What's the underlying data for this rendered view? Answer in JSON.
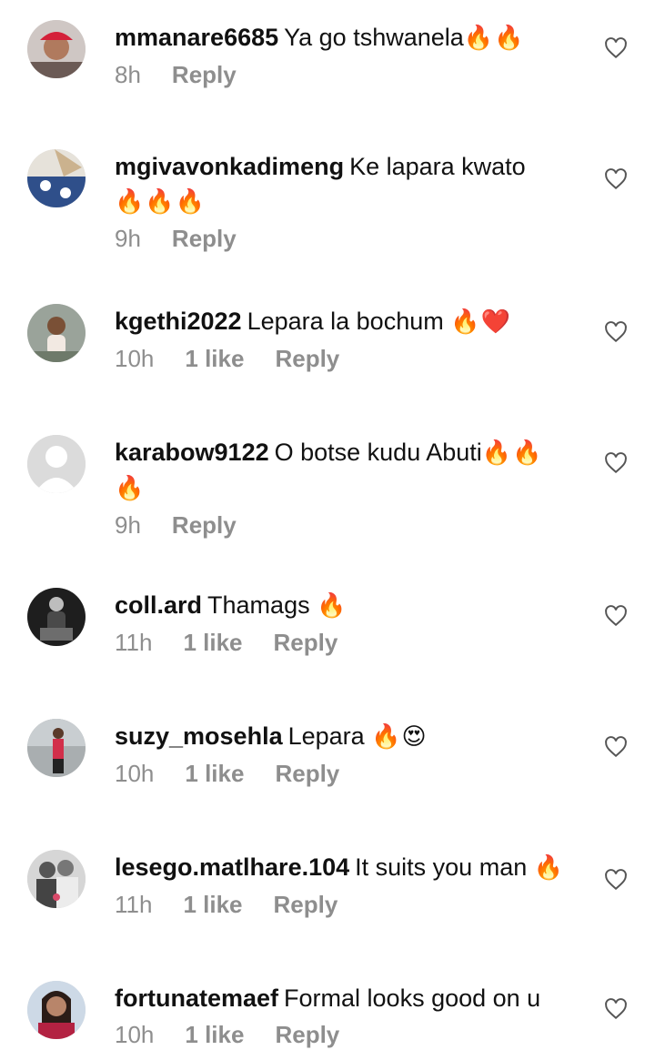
{
  "comments": [
    {
      "username": "mmanare6685",
      "text": "Ya go tshwanela",
      "emoji": "🔥🔥",
      "time": "8h",
      "likes": "",
      "reply": "Reply",
      "avatar": "avatar-woman-red-cap"
    },
    {
      "username": "mgivavonkadimeng",
      "text": "Ke lapara kwato",
      "emoji": "🔥🔥🔥",
      "time": "9h",
      "likes": "",
      "reply": "Reply",
      "avatar": "avatar-blue-pattern"
    },
    {
      "username": "kgethi2022",
      "text": "Lepara la bochum",
      "emoji": "🔥❤️",
      "time": "10h",
      "likes": "1 like",
      "reply": "Reply",
      "avatar": "avatar-child"
    },
    {
      "username": "karabow9122",
      "text": "O botse kudu Abuti",
      "emoji": "🔥🔥🔥",
      "time": "9h",
      "likes": "",
      "reply": "Reply",
      "avatar": "avatar-default"
    },
    {
      "username": "coll.ard",
      "text": "Thamags",
      "emoji": "🔥",
      "time": "11h",
      "likes": "1 like",
      "reply": "Reply",
      "avatar": "avatar-seated-man-bw"
    },
    {
      "username": "suzy_mosehla",
      "text": "Lepara",
      "emoji": "🔥😍",
      "time": "10h",
      "likes": "1 like",
      "reply": "Reply",
      "avatar": "avatar-woman-street"
    },
    {
      "username": "lesego.matlhare.104",
      "text": "It suits you man",
      "emoji": "🔥",
      "time": "11h",
      "likes": "1 like",
      "reply": "Reply",
      "avatar": "avatar-couple-bw"
    },
    {
      "username": "fortunatemaef",
      "text": "Formal looks good on u",
      "emoji": "",
      "time": "10h",
      "likes": "1 like",
      "reply": "Reply",
      "avatar": "avatar-woman-smiling"
    }
  ]
}
